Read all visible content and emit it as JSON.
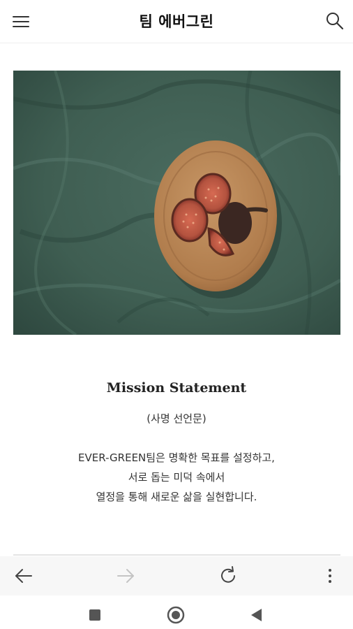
{
  "header": {
    "title": "팀 에버그린",
    "menu_icon": "hamburger-menu-icon",
    "search_icon": "search-icon"
  },
  "hero_image": {
    "description_icon": "fig-plate-photo",
    "colors": {
      "cloth": "#3f5e52",
      "plate": "#b07c4c",
      "fig": "#b4533f"
    }
  },
  "mission": {
    "title": "Mission Statement",
    "subtitle": "(사명 선언문)",
    "lines": [
      "EVER-GREEN팀은 명확한 목표를 설정하고,",
      "서로 돕는 미덕 속에서",
      "열정을 통해 새로운 삶을 실현합니다."
    ]
  },
  "browser_toolbar": {
    "back_icon": "arrow-left-icon",
    "forward_icon": "arrow-right-icon",
    "reload_icon": "reload-icon",
    "more_icon": "more-vertical-icon"
  },
  "system_nav": {
    "recents_icon": "square-icon",
    "home_icon": "circle-icon",
    "back_icon": "triangle-back-icon"
  }
}
